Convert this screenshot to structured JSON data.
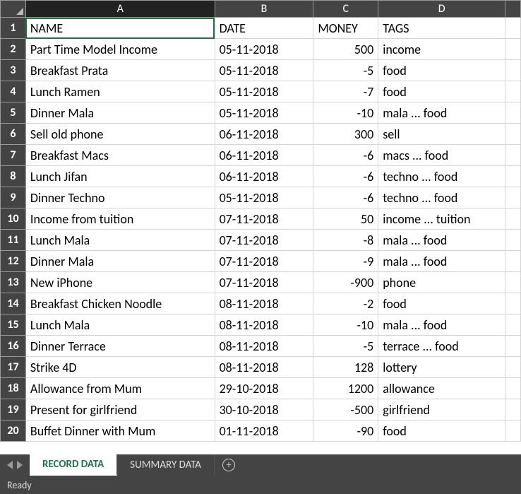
{
  "columns": [
    "A",
    "B",
    "C",
    "D"
  ],
  "activeColumn": "A",
  "activeCell": {
    "row": 1,
    "col": "A"
  },
  "headers": {
    "A": "NAME",
    "B": "DATE",
    "C": "MONEY",
    "D": "TAGS"
  },
  "rows": [
    {
      "n": 2,
      "A": "Part Time Model Income",
      "B": "05-11-2018",
      "C": "500",
      "D": "income"
    },
    {
      "n": 3,
      "A": "Breakfast Prata",
      "B": "05-11-2018",
      "C": "-5",
      "D": "food"
    },
    {
      "n": 4,
      "A": "Lunch Ramen",
      "B": "05-11-2018",
      "C": "-7",
      "D": "food"
    },
    {
      "n": 5,
      "A": "Dinner Mala",
      "B": "05-11-2018",
      "C": "-10",
      "D": "mala  ... food"
    },
    {
      "n": 6,
      "A": "Sell old phone",
      "B": "06-11-2018",
      "C": "300",
      "D": "sell"
    },
    {
      "n": 7,
      "A": "Breakfast Macs",
      "B": "06-11-2018",
      "C": "-6",
      "D": "macs  ... food"
    },
    {
      "n": 8,
      "A": "Lunch Jifan",
      "B": "06-11-2018",
      "C": "-6",
      "D": "techno  ... food"
    },
    {
      "n": 9,
      "A": "Dinner Techno",
      "B": "05-11-2018",
      "C": "-6",
      "D": "techno  ... food"
    },
    {
      "n": 10,
      "A": "Income from tuition",
      "B": "07-11-2018",
      "C": "50",
      "D": "income  ... tuition"
    },
    {
      "n": 11,
      "A": "Lunch Mala",
      "B": "07-11-2018",
      "C": "-8",
      "D": "mala  ... food"
    },
    {
      "n": 12,
      "A": "Dinner Mala",
      "B": "07-11-2018",
      "C": "-9",
      "D": "mala  ... food"
    },
    {
      "n": 13,
      "A": "New iPhone",
      "B": "07-11-2018",
      "C": "-900",
      "D": "phone"
    },
    {
      "n": 14,
      "A": "Breakfast Chicken Noodle",
      "B": "08-11-2018",
      "C": "-2",
      "D": "food"
    },
    {
      "n": 15,
      "A": "Lunch Mala",
      "B": "08-11-2018",
      "C": "-10",
      "D": "mala  ... food"
    },
    {
      "n": 16,
      "A": "Dinner Terrace",
      "B": "08-11-2018",
      "C": "-5",
      "D": "terrace  ... food"
    },
    {
      "n": 17,
      "A": "Strike 4D",
      "B": "08-11-2018",
      "C": "128",
      "D": "lottery"
    },
    {
      "n": 18,
      "A": "Allowance from Mum",
      "B": "29-10-2018",
      "C": "1200",
      "D": "allowance"
    },
    {
      "n": 19,
      "A": "Present for girlfriend",
      "B": "30-10-2018",
      "C": "-500",
      "D": "girlfriend"
    },
    {
      "n": 20,
      "A": "Buffet Dinner with Mum",
      "B": "01-11-2018",
      "C": "-90",
      "D": "food"
    }
  ],
  "tabs": [
    {
      "label": "RECORD DATA",
      "active": true
    },
    {
      "label": "SUMMARY DATA",
      "active": false
    }
  ],
  "status": "Ready",
  "plusGlyph": "+"
}
